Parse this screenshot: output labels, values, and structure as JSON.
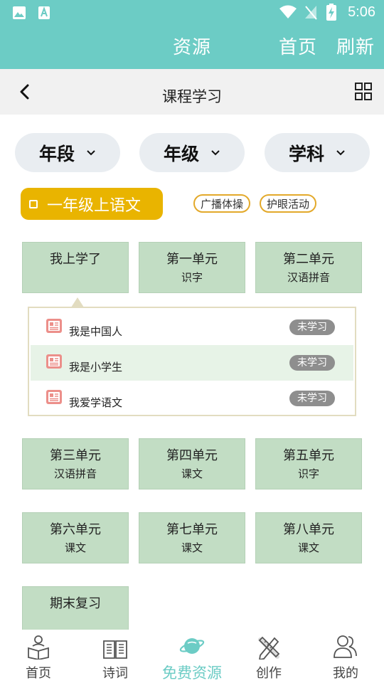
{
  "status_bar": {
    "time": "5:06"
  },
  "header": {
    "title": "资源",
    "home": "首页",
    "refresh": "刷新"
  },
  "subheader": {
    "title": "课程学习"
  },
  "filters": [
    {
      "label": "年段"
    },
    {
      "label": "年级"
    },
    {
      "label": "学科"
    }
  ],
  "course": {
    "current": "一年级上语文",
    "chips": [
      "广播体操",
      "护眼活动"
    ]
  },
  "units": [
    {
      "title": "我上学了",
      "subtitle": ""
    },
    {
      "title": "第一单元",
      "subtitle": "识字"
    },
    {
      "title": "第二单元",
      "subtitle": "汉语拼音"
    },
    {
      "title": "第三单元",
      "subtitle": "汉语拼音"
    },
    {
      "title": "第四单元",
      "subtitle": "课文"
    },
    {
      "title": "第五单元",
      "subtitle": "识字"
    },
    {
      "title": "第六单元",
      "subtitle": "课文"
    },
    {
      "title": "第七单元",
      "subtitle": "课文"
    },
    {
      "title": "第八单元",
      "subtitle": "课文"
    },
    {
      "title": "期末复习",
      "subtitle": ""
    }
  ],
  "lessons": [
    {
      "name": "我是中国人",
      "status": "未学习"
    },
    {
      "name": "我是小学生",
      "status": "未学习"
    },
    {
      "name": "我爱学语文",
      "status": "未学习"
    }
  ],
  "bottom_nav": [
    {
      "label": "首页",
      "icon": "reader-icon"
    },
    {
      "label": "诗词",
      "icon": "book-icon"
    },
    {
      "label": "免费资源",
      "icon": "planet-icon",
      "active": true
    },
    {
      "label": "创作",
      "icon": "pencil-ruler-icon"
    },
    {
      "label": "我的",
      "icon": "users-icon"
    }
  ],
  "colors": {
    "header": "#6cccc5",
    "unit_tile": "#c2ddc4",
    "course_tag": "#e9b400",
    "chip_border": "#e3a92a",
    "status_badge": "#8e8e8e",
    "lesson_highlight": "#e7f3e7",
    "active_tab": "#6cccc5"
  }
}
